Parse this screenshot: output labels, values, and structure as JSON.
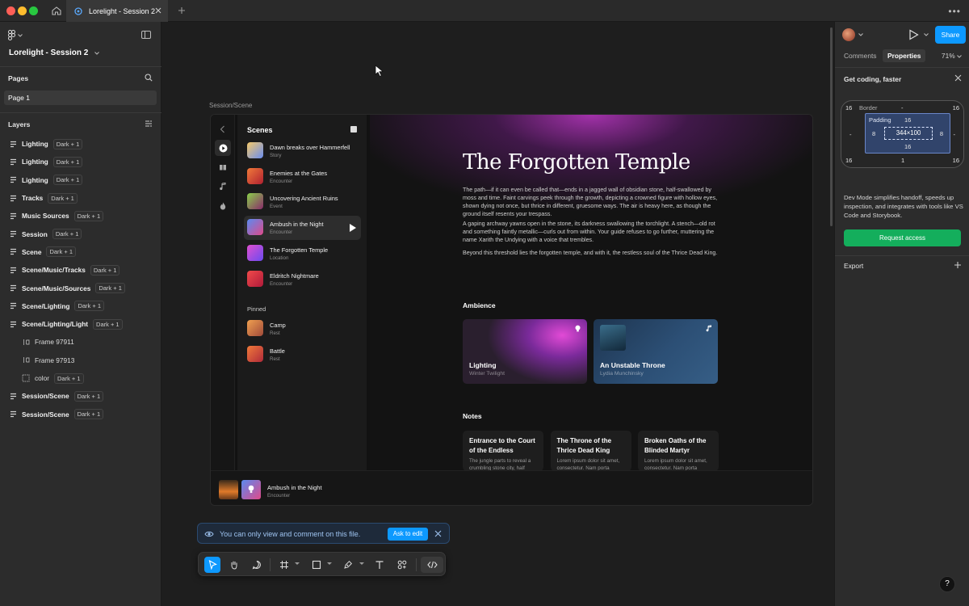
{
  "titlebar": {
    "tab_title": "Lorelight - Session 2"
  },
  "left": {
    "file_title": "Lorelight - Session 2",
    "pages_title": "Pages",
    "page_item": "Page 1",
    "layers_title": "Layers",
    "layers": [
      {
        "name": "Lighting",
        "badge": "Dark + 1",
        "type": "component",
        "indent": false
      },
      {
        "name": "Lighting",
        "badge": "Dark + 1",
        "type": "component",
        "indent": false
      },
      {
        "name": "Lighting",
        "badge": "Dark + 1",
        "type": "component",
        "indent": false
      },
      {
        "name": "Tracks",
        "badge": "Dark + 1",
        "type": "component",
        "indent": false
      },
      {
        "name": "Music Sources",
        "badge": "Dark + 1",
        "type": "component",
        "indent": false
      },
      {
        "name": "Session",
        "badge": "Dark + 1",
        "type": "component",
        "indent": false
      },
      {
        "name": "Scene",
        "badge": "Dark + 1",
        "type": "component",
        "indent": false
      },
      {
        "name": "Scene/Music/Tracks",
        "badge": "Dark + 1",
        "type": "component",
        "indent": false
      },
      {
        "name": "Scene/Music/Sources",
        "badge": "Dark + 1",
        "type": "component",
        "indent": false
      },
      {
        "name": "Scene/Lighting",
        "badge": "Dark + 1",
        "type": "component",
        "indent": false
      },
      {
        "name": "Scene/Lighting/Light",
        "badge": "Dark + 1",
        "type": "component",
        "indent": false
      },
      {
        "name": "Frame 97911",
        "badge": "",
        "type": "frame",
        "indent": true
      },
      {
        "name": "Frame 97913",
        "badge": "",
        "type": "frame",
        "indent": true
      },
      {
        "name": "color",
        "badge": "Dark + 1",
        "type": "color",
        "indent": true
      },
      {
        "name": "Session/Scene",
        "badge": "Dark + 1",
        "type": "component",
        "indent": false
      },
      {
        "name": "Session/Scene",
        "badge": "Dark + 1",
        "type": "component",
        "indent": false
      }
    ]
  },
  "canvas": {
    "frame_label": "Session/Scene",
    "scenes_title": "Scenes",
    "scenes": [
      {
        "title": "Dawn breaks over Hammerfell",
        "sub": "Story",
        "grad": "linear-gradient(135deg,#f5c96a,#6a8df0)"
      },
      {
        "title": "Enemies at the Gates",
        "sub": "Encounter",
        "grad": "linear-gradient(135deg,#f07a3a,#b02030)"
      },
      {
        "title": "Uncovering Ancient Ruins",
        "sub": "Event",
        "grad": "linear-gradient(135deg,#8ad04a,#8a2a6a)"
      },
      {
        "title": "Ambush in the Night",
        "sub": "Encounter",
        "grad": "linear-gradient(135deg,#5a8af0,#e04a8a)"
      },
      {
        "title": "The Forgotten Temple",
        "sub": "Location",
        "grad": "linear-gradient(135deg,#e050d0,#6a4af0)"
      },
      {
        "title": "Eldritch Nightmare",
        "sub": "Encounter",
        "grad": "linear-gradient(135deg,#f04a4a,#b01a3a)"
      }
    ],
    "pinned_title": "Pinned",
    "pinned": [
      {
        "title": "Camp",
        "sub": "Rest",
        "grad": "linear-gradient(135deg,#f0a050,#a04a3a)"
      },
      {
        "title": "Battle",
        "sub": "Rest",
        "grad": "linear-gradient(135deg,#f07a3a,#b02a3a)"
      }
    ],
    "main_title": "The Forgotten Temple",
    "paragraphs": [
      "The path—if it can even be called that—ends in a jagged wall of obsidian stone, half-swallowed by moss and time. Faint carvings peek through the growth, depicting a crowned figure with hollow eyes, shown dying not once, but thrice in different, gruesome ways. The air is heavy here, as though the ground itself resents your trespass.",
      "A gaping archway yawns open in the stone, its darkness swallowing the torchlight. A stench—old rot and something faintly metallic—curls out from within. Your guide refuses to go further, muttering the name Xarith the Undying with a voice that trembles.",
      "Beyond this threshold lies the forgotten temple, and with it, the restless soul of the Thrice Dead King."
    ],
    "ambience_title": "Ambience",
    "ambience": [
      {
        "title": "Lighting",
        "sub": "Winter Twilight"
      },
      {
        "title": "An Unstable Throne",
        "sub": "Lydia Munchinsky"
      }
    ],
    "notes_title": "Notes",
    "notes": [
      {
        "title": "Entrance to the Court of the Endless",
        "body": "The jungle parts to reveal a crumbling stone city, half"
      },
      {
        "title": "The Throne of the Thrice Dead King",
        "body": "Lorem ipsum dolor sit amet, consectetur. Nam porta"
      },
      {
        "title": "Broken Oaths of the Blinded Martyr",
        "body": "Lorem ipsum dolor sit amet, consectetur. Nam porta"
      }
    ],
    "player": {
      "title": "Ambush in the Night",
      "sub": "Encounter"
    }
  },
  "toast": {
    "message": "You can only view and comment on this file.",
    "button": "Ask to edit"
  },
  "right": {
    "share": "Share",
    "tab_comments": "Comments",
    "tab_properties": "Properties",
    "zoom": "71%",
    "get_coding": "Get coding, faster",
    "box": {
      "border_label": "Border",
      "border_value": "-",
      "padding_label": "Padding",
      "corner": "16",
      "pad_top": "16",
      "pad_bottom": "16",
      "pad_left": "8",
      "pad_right": "8",
      "margin_side": "-",
      "bottom": "1",
      "size": "344×100"
    },
    "desc": "Dev Mode simplifies handoff, speeds up inspection, and integrates with tools like VS Code and Storybook.",
    "request": "Request access",
    "export": "Export"
  },
  "help": "?"
}
